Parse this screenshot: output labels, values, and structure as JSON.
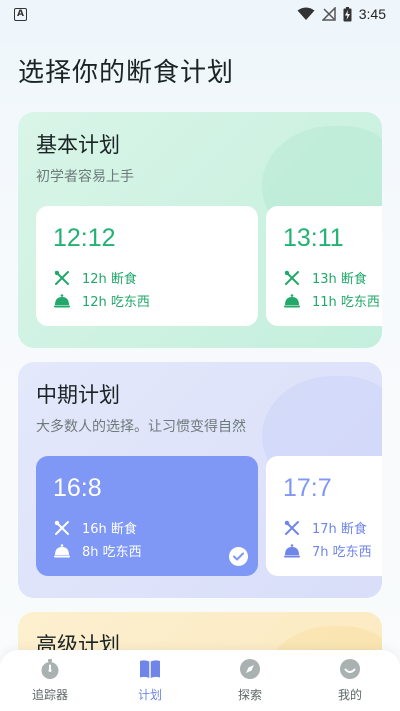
{
  "status": {
    "time": "3:45",
    "badge": "A"
  },
  "page_title": "选择你的断食计划",
  "sections": {
    "basic": {
      "title": "基本计划",
      "subtitle": "初学者容易上手",
      "plans": [
        {
          "name": "12:12",
          "fast": "12h 断食",
          "eat": "12h 吃东西"
        },
        {
          "name": "13:11",
          "fast": "13h 断食",
          "eat": "11h 吃东西"
        }
      ]
    },
    "mid": {
      "title": "中期计划",
      "subtitle": "大多数人的选择。让习惯变得自然",
      "plans": [
        {
          "name": "16:8",
          "fast": "16h 断食",
          "eat": "8h 吃东西",
          "selected": true
        },
        {
          "name": "17:7",
          "fast": "17h 断食",
          "eat": "7h 吃东西"
        }
      ]
    },
    "advanced": {
      "title": "高级计划"
    }
  },
  "nav": {
    "items": [
      {
        "label": "追踪器",
        "icon": "stopwatch-icon"
      },
      {
        "label": "计划",
        "icon": "book-icon",
        "active": true
      },
      {
        "label": "探索",
        "icon": "compass-icon"
      },
      {
        "label": "我的",
        "icon": "profile-icon"
      }
    ]
  },
  "colors": {
    "green": "#22b273",
    "blue": "#7f97f5",
    "nav_active": "#6f86e8"
  }
}
